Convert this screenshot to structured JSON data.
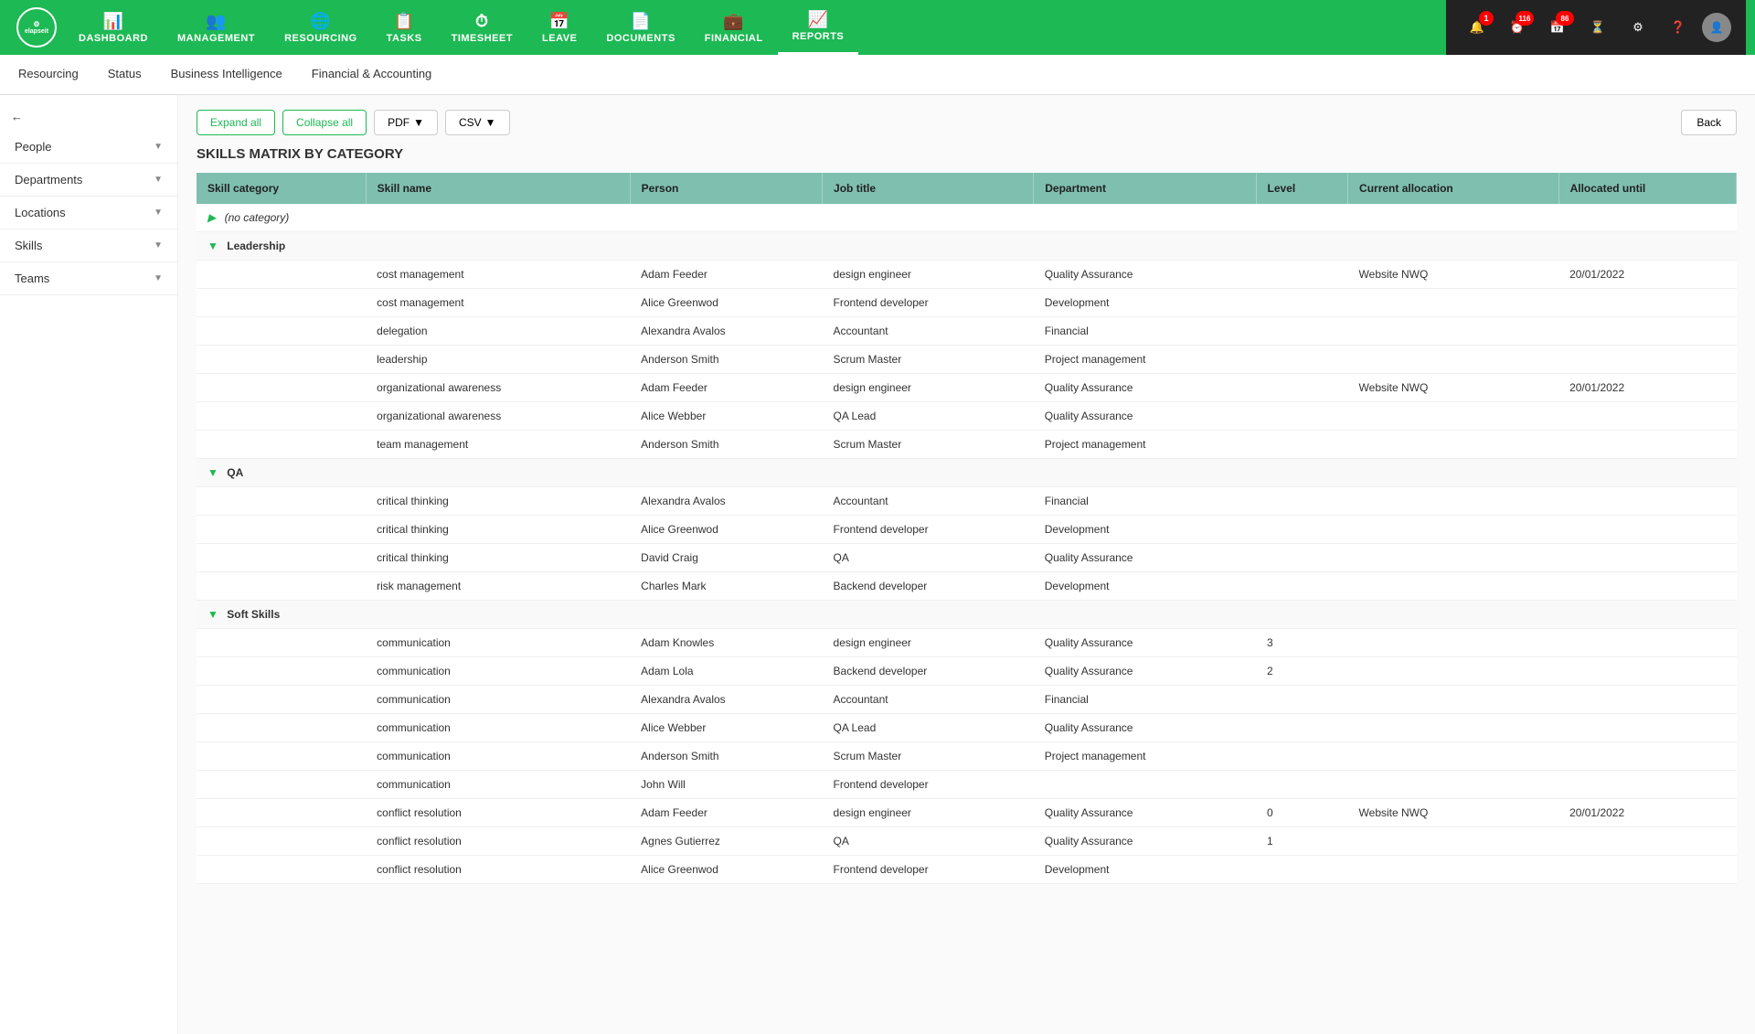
{
  "app": {
    "logo_text": "elapseit"
  },
  "nav": {
    "items": [
      {
        "label": "DASHBOARD",
        "icon": "📊",
        "active": false
      },
      {
        "label": "MANAGEMENT",
        "icon": "👥",
        "active": false
      },
      {
        "label": "RESOURCING",
        "icon": "🌐",
        "active": false
      },
      {
        "label": "TASKS",
        "icon": "📋",
        "active": false
      },
      {
        "label": "TIMESHEET",
        "icon": "⏱",
        "active": false
      },
      {
        "label": "LEAVE",
        "icon": "📅",
        "active": false
      },
      {
        "label": "DOCUMENTS",
        "icon": "📄",
        "active": false
      },
      {
        "label": "FINANCIAL",
        "icon": "💼",
        "active": false
      },
      {
        "label": "REPORTS",
        "icon": "📈",
        "active": true
      }
    ],
    "badges": [
      {
        "icon": "🔔",
        "count": "1"
      },
      {
        "icon": "⏰",
        "count": "116"
      },
      {
        "icon": "📅",
        "count": "86"
      },
      {
        "icon": "⏳",
        "count": ""
      }
    ]
  },
  "sub_nav": {
    "items": [
      "Resourcing",
      "Status",
      "Business Intelligence",
      "Financial & Accounting"
    ]
  },
  "sidebar": {
    "filters": [
      {
        "label": "People"
      },
      {
        "label": "Departments"
      },
      {
        "label": "Locations"
      },
      {
        "label": "Skills"
      },
      {
        "label": "Teams"
      }
    ]
  },
  "toolbar": {
    "expand_all": "Expand all",
    "collapse_all": "Collapse all",
    "pdf": "PDF",
    "csv": "CSV",
    "back": "Back"
  },
  "page": {
    "title": "SKILLS MATRIX BY CATEGORY"
  },
  "table": {
    "headers": [
      "Skill category",
      "Skill name",
      "Person",
      "Job title",
      "Department",
      "Level",
      "Current allocation",
      "Allocated until"
    ],
    "sections": [
      {
        "type": "no-category",
        "label": "(no category)",
        "rows": []
      },
      {
        "type": "category",
        "label": "Leadership",
        "rows": [
          {
            "skill": "cost management",
            "person": "Adam Feeder",
            "job_title": "design engineer",
            "department": "Quality Assurance",
            "level": "",
            "current_allocation": "Website NWQ",
            "allocated_until": "20/01/2022"
          },
          {
            "skill": "cost management",
            "person": "Alice Greenwod",
            "job_title": "Frontend developer",
            "department": "Development",
            "level": "",
            "current_allocation": "",
            "allocated_until": ""
          },
          {
            "skill": "delegation",
            "person": "Alexandra Avalos",
            "job_title": "Accountant",
            "department": "Financial",
            "level": "",
            "current_allocation": "",
            "allocated_until": ""
          },
          {
            "skill": "leadership",
            "person": "Anderson Smith",
            "job_title": "Scrum Master",
            "department": "Project management",
            "level": "",
            "current_allocation": "",
            "allocated_until": ""
          },
          {
            "skill": "organizational awareness",
            "person": "Adam Feeder",
            "job_title": "design engineer",
            "department": "Quality Assurance",
            "level": "",
            "current_allocation": "Website NWQ",
            "allocated_until": "20/01/2022"
          },
          {
            "skill": "organizational awareness",
            "person": "Alice Webber",
            "job_title": "QA Lead",
            "department": "Quality Assurance",
            "level": "",
            "current_allocation": "",
            "allocated_until": ""
          },
          {
            "skill": "team management",
            "person": "Anderson Smith",
            "job_title": "Scrum Master",
            "department": "Project management",
            "level": "",
            "current_allocation": "",
            "allocated_until": ""
          }
        ]
      },
      {
        "type": "category",
        "label": "QA",
        "rows": [
          {
            "skill": "critical thinking",
            "person": "Alexandra Avalos",
            "job_title": "Accountant",
            "department": "Financial",
            "level": "",
            "current_allocation": "",
            "allocated_until": ""
          },
          {
            "skill": "critical thinking",
            "person": "Alice Greenwod",
            "job_title": "Frontend developer",
            "department": "Development",
            "level": "",
            "current_allocation": "",
            "allocated_until": ""
          },
          {
            "skill": "critical thinking",
            "person": "David Craig",
            "job_title": "QA",
            "department": "Quality Assurance",
            "level": "",
            "current_allocation": "",
            "allocated_until": ""
          },
          {
            "skill": "risk management",
            "person": "Charles Mark",
            "job_title": "Backend developer",
            "department": "Development",
            "level": "",
            "current_allocation": "",
            "allocated_until": ""
          }
        ]
      },
      {
        "type": "category",
        "label": "Soft Skills",
        "rows": [
          {
            "skill": "communication",
            "person": "Adam Knowles",
            "job_title": "design engineer",
            "department": "Quality Assurance",
            "level": "3",
            "current_allocation": "",
            "allocated_until": ""
          },
          {
            "skill": "communication",
            "person": "Adam Lola",
            "job_title": "Backend developer",
            "department": "Quality Assurance",
            "level": "2",
            "current_allocation": "",
            "allocated_until": ""
          },
          {
            "skill": "communication",
            "person": "Alexandra Avalos",
            "job_title": "Accountant",
            "department": "Financial",
            "level": "",
            "current_allocation": "",
            "allocated_until": ""
          },
          {
            "skill": "communication",
            "person": "Alice Webber",
            "job_title": "QA Lead",
            "department": "Quality Assurance",
            "level": "",
            "current_allocation": "",
            "allocated_until": ""
          },
          {
            "skill": "communication",
            "person": "Anderson Smith",
            "job_title": "Scrum Master",
            "department": "Project management",
            "level": "",
            "current_allocation": "",
            "allocated_until": ""
          },
          {
            "skill": "communication",
            "person": "John Will",
            "job_title": "Frontend developer",
            "department": "",
            "level": "",
            "current_allocation": "",
            "allocated_until": ""
          },
          {
            "skill": "conflict resolution",
            "person": "Adam Feeder",
            "job_title": "design engineer",
            "department": "Quality Assurance",
            "level": "0",
            "current_allocation": "Website NWQ",
            "allocated_until": "20/01/2022"
          },
          {
            "skill": "conflict resolution",
            "person": "Agnes Gutierrez",
            "job_title": "QA",
            "department": "Quality Assurance",
            "level": "1",
            "current_allocation": "",
            "allocated_until": ""
          },
          {
            "skill": "conflict resolution",
            "person": "Alice Greenwod",
            "job_title": "Frontend developer",
            "department": "Development",
            "level": "",
            "current_allocation": "",
            "allocated_until": ""
          }
        ]
      }
    ]
  }
}
